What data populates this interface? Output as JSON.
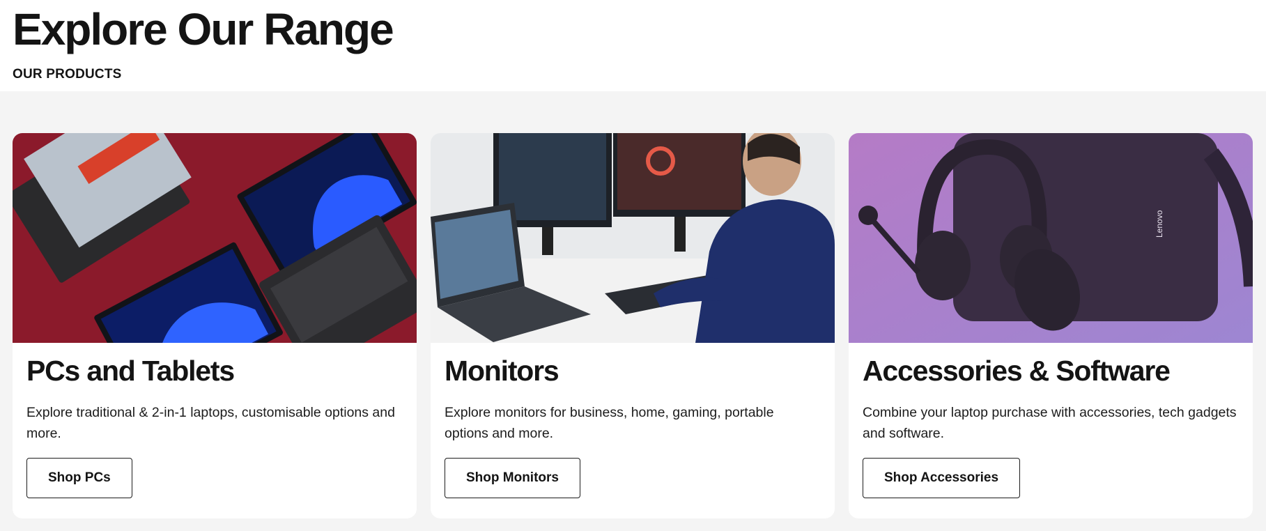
{
  "header": {
    "title": "Explore Our Range",
    "subtitle": "OUR PRODUCTS"
  },
  "cards": [
    {
      "title": "PCs and Tablets",
      "description": "Explore traditional & 2-in-1 laptops, customisable options and more.",
      "button_label": "Shop PCs",
      "image_icon": "laptops-image",
      "accent": "#8b1a2b"
    },
    {
      "title": "Monitors",
      "description": "Explore monitors for business, home, gaming, portable options and more.",
      "button_label": "Shop Monitors",
      "image_icon": "monitors-workstation-image",
      "accent": "#1f2f6b"
    },
    {
      "title": "Accessories & Software",
      "description": "Combine your laptop purchase with accessories, tech gadgets and software.",
      "button_label": "Shop Accessories",
      "image_icon": "accessories-image",
      "accent": "#b77cc4",
      "brand_text": "Lenovo"
    }
  ]
}
